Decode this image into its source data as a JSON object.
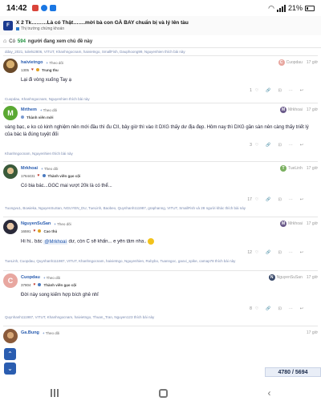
{
  "status_bar": {
    "time": "14:42",
    "battery": "21%",
    "icon_colors": [
      "#d9443a",
      "#1a77e3",
      "#1a77e3"
    ]
  },
  "topic": {
    "title": "X 2 Tk………Là có Thật…….mời bà con GÀ BAY chuẩn bị và lý lên tàu",
    "category": "Thị trường chứng khoán"
  },
  "viewers": {
    "count": "594",
    "label": "người đang xem chủ đề này"
  },
  "posts": [
    {
      "likes_line": "dday_2021, tuliels2806, VITUT, Khanhngocnam, haivietngo, SmallFish, Dauphoong99, Nguyenhien thích bài này"
    },
    {
      "username": "haivietngo",
      "follow": "Theo dõi",
      "reply_to": "",
      "reply_initial": "C",
      "reply_color": "#e8a7a0",
      "reply_name": "Cuopdau",
      "time": "17 giờ",
      "score": "1305",
      "stat_title": "Trung thu",
      "body": "Lại đi vòng xuống Tay ạ",
      "like_count": "1",
      "likes_line": "Cuopdau, Khanhngocnam, Nguyenhien thích bài này"
    },
    {
      "username": "Mrthem",
      "follow": "Theo dõi",
      "avatar_initial": "M",
      "avatar_color": "#5aa832",
      "reply_name": "Mrkhoai",
      "reply_initial": "M",
      "reply_color": "#6a5a8a",
      "time": "17 giờ",
      "stat_title": "Thành viên mới",
      "body": "vàng bạc, e ko có kinh nghiệm nên mới đầu thì đu CII, bây giờ thì vào ít DXG thấy dư địa đẹp. Hôm nay thì DXG gần sàn nên càng thấy triết lý của bác là đúng tuyệt đối",
      "like_count": "3",
      "likes_line": "Khanhngocnam, Nguyenhien thích bài này"
    },
    {
      "username": "Mrkhoai",
      "follow": "Theo dõi",
      "reply_name": "TueLinh",
      "reply_initial": "T",
      "reply_color": "#7ab060",
      "time": "17 giờ",
      "score": "1764431",
      "stat_title": "Thành viên gạo cội",
      "body": "Có bia bác...GGC mai vượt 20k là có thể...",
      "like_count": "17",
      "likes_line": "Tuongvu1, Bowieka, NguyenSuSan, NGUYEN_DU, TueLinh, Baobeo, Quynhanh111987, graphanng, VITUT, SmallFish và 28 người khác thích bài này"
    },
    {
      "username": "NguyenSuSan",
      "follow": "Theo dõi",
      "reply_name": "Mrkhoai",
      "reply_initial": "M",
      "reply_color": "#6a5a8a",
      "time": "17 giờ",
      "score": "16591",
      "stat_title": "Cao thủ",
      "body_before": "Hi hi.. bác ",
      "mention": "@Mrkhoai",
      "body_after": " dư, còn C sẽ khấn... e yên tâm nha..",
      "like_count": "12",
      "likes_line": "TueLinh, Cuopdau, Quynhanh111987, VITUT, Khanhngocnam, haivietngo, Nguyenhien, Rubybo, Tuanngoc, gaovi_spike, camap78 thích bài này"
    },
    {
      "username": "Cuopdau",
      "follow": "Theo dõi",
      "avatar_initial": "C",
      "avatar_color": "#e8a7a0",
      "reply_name": "NguyenSuSan",
      "reply_initial": "N",
      "reply_color": "#3a4a6a",
      "time": "17 giờ",
      "score": "37804",
      "stat_title": "Thành viên gạo cội",
      "body": "Đời này song kiếm hợp bích ghê nhỉ",
      "like_count": "8",
      "likes_line": "Quynhanh111987, VITUT, Khanhngocnam, haivietngo, Thuan_Tran, Nguyen123 thích bài này"
    },
    {
      "username": "Ga.Bung",
      "follow": "Theo dõi",
      "time": "17 giờ"
    }
  ],
  "progress": {
    "current": "4780",
    "total": "5694",
    "text": "4780 / 5694"
  }
}
